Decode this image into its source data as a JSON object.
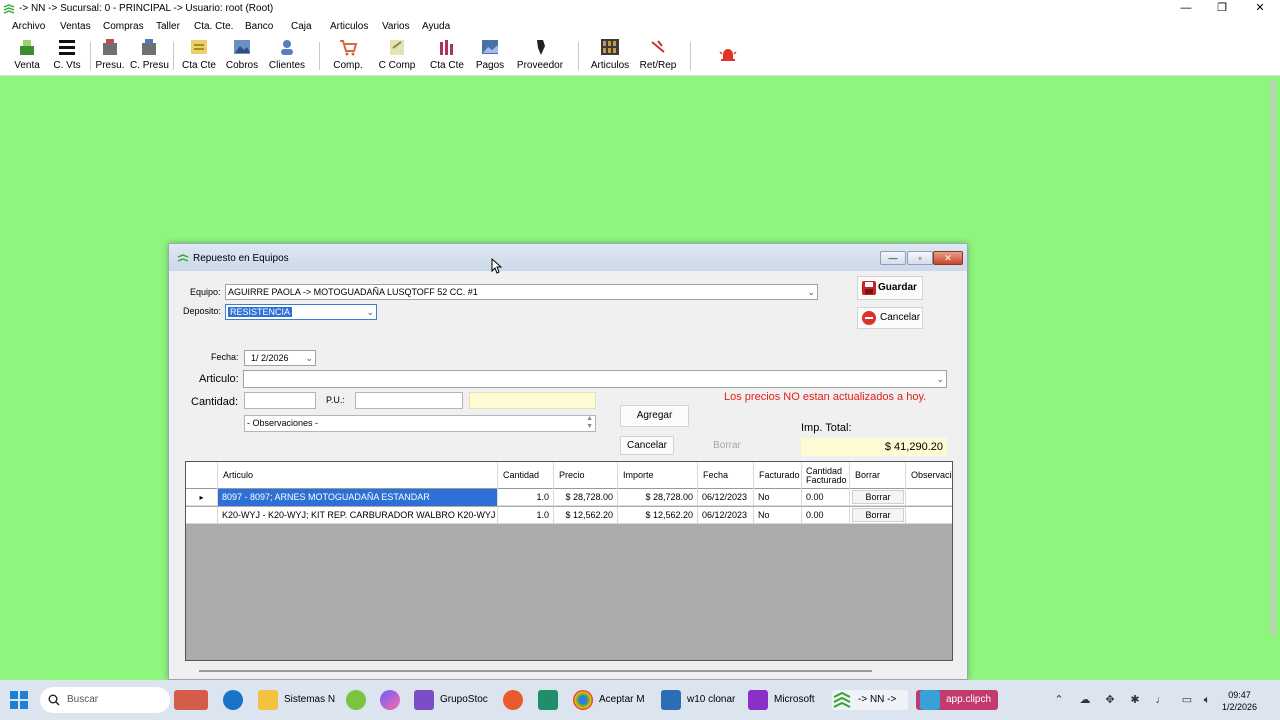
{
  "window": {
    "title": "-> NN -> Sucursal: 0 - PRINCIPAL -> Usuario: root (Root)",
    "minimize": "—",
    "maximize": "❐",
    "close": "✕"
  },
  "menu": [
    "Archivo",
    "Ventas",
    "Compras",
    "Taller",
    "Cta. Cte.",
    "Banco",
    "Caja",
    "Articulos",
    "Varios",
    "Ayuda"
  ],
  "toolbar": [
    "Venta",
    "C. Vts",
    "Presu.",
    "C. Presu",
    "Cta Cte",
    "Cobros",
    "Clientes",
    "Comp.",
    "C Comp",
    "Cta Cte",
    "Pagos",
    "Proveedor",
    "Articulos",
    "Ret/Rep"
  ],
  "dialog": {
    "title": "Repuesto en Equipos",
    "minimize": "—",
    "maximize": "▫",
    "close": "✕",
    "equipo_label": "Equipo:",
    "equipo_value": "AGUIRRE PAOLA -> MOTOGUADAÑA LUSQTOFF 52 CC.  #1",
    "deposito_label": "Deposito:",
    "deposito_value": "RESISTENCIA",
    "guardar": "Guardar",
    "cancelar_top": "Cancelar",
    "fecha_label": "Fecha:",
    "fecha_value": "1/  2/2026",
    "articulo_label": "Articulo:",
    "articulo_value": "",
    "cantidad_label": "Cantidad:",
    "pu_label": "P.U.:",
    "observaciones": "- Observaciones -",
    "warning": "Los precios NO estan actualizados a hoy.",
    "agregar": "Agregar",
    "cancelar": "Cancelar",
    "borrar": "Borrar",
    "imp_total_label": "Imp. Total:",
    "imp_total_value": "$ 41,290.20"
  },
  "grid": {
    "headers": [
      "Articulo",
      "Cantidad",
      "Precio",
      "Importe",
      "Fecha",
      "Facturado",
      "Cantidad Facturado",
      "Borrar",
      "Observacio"
    ],
    "rows": [
      {
        "articulo": "8097 - 8097; ARNES MOTOGUADAÑA ESTANDAR",
        "cantidad": "1.0",
        "precio": "$ 28,728.00",
        "importe": "$ 28,728.00",
        "fecha": "06/12/2023",
        "facturado": "No",
        "cant_fact": "0.00",
        "borrar": "Borrar",
        "obs": ""
      },
      {
        "articulo": "K20-WYJ - K20-WYJ; KIT REP. CARBURADOR WALBRO K20-WYJ",
        "cantidad": "1.0",
        "precio": "$ 12,562.20",
        "importe": "$ 12,562.20",
        "fecha": "06/12/2023",
        "facturado": "No",
        "cant_fact": "0.00",
        "borrar": "Borrar",
        "obs": ""
      }
    ]
  },
  "taskbar": {
    "search_placeholder": "Buscar",
    "items": [
      "Sistemas N",
      "GrupoStoc",
      "Aceptar M",
      "w10 clonar",
      "Microsoft",
      "-> NN ->",
      "app.clipch"
    ],
    "time": "09:47",
    "date": "1/2/2026"
  },
  "colors": {
    "desktop": "#8ef57d",
    "warning": "#e0201b",
    "selection": "#2f70d6",
    "total_bg": "#fdfbd3"
  }
}
